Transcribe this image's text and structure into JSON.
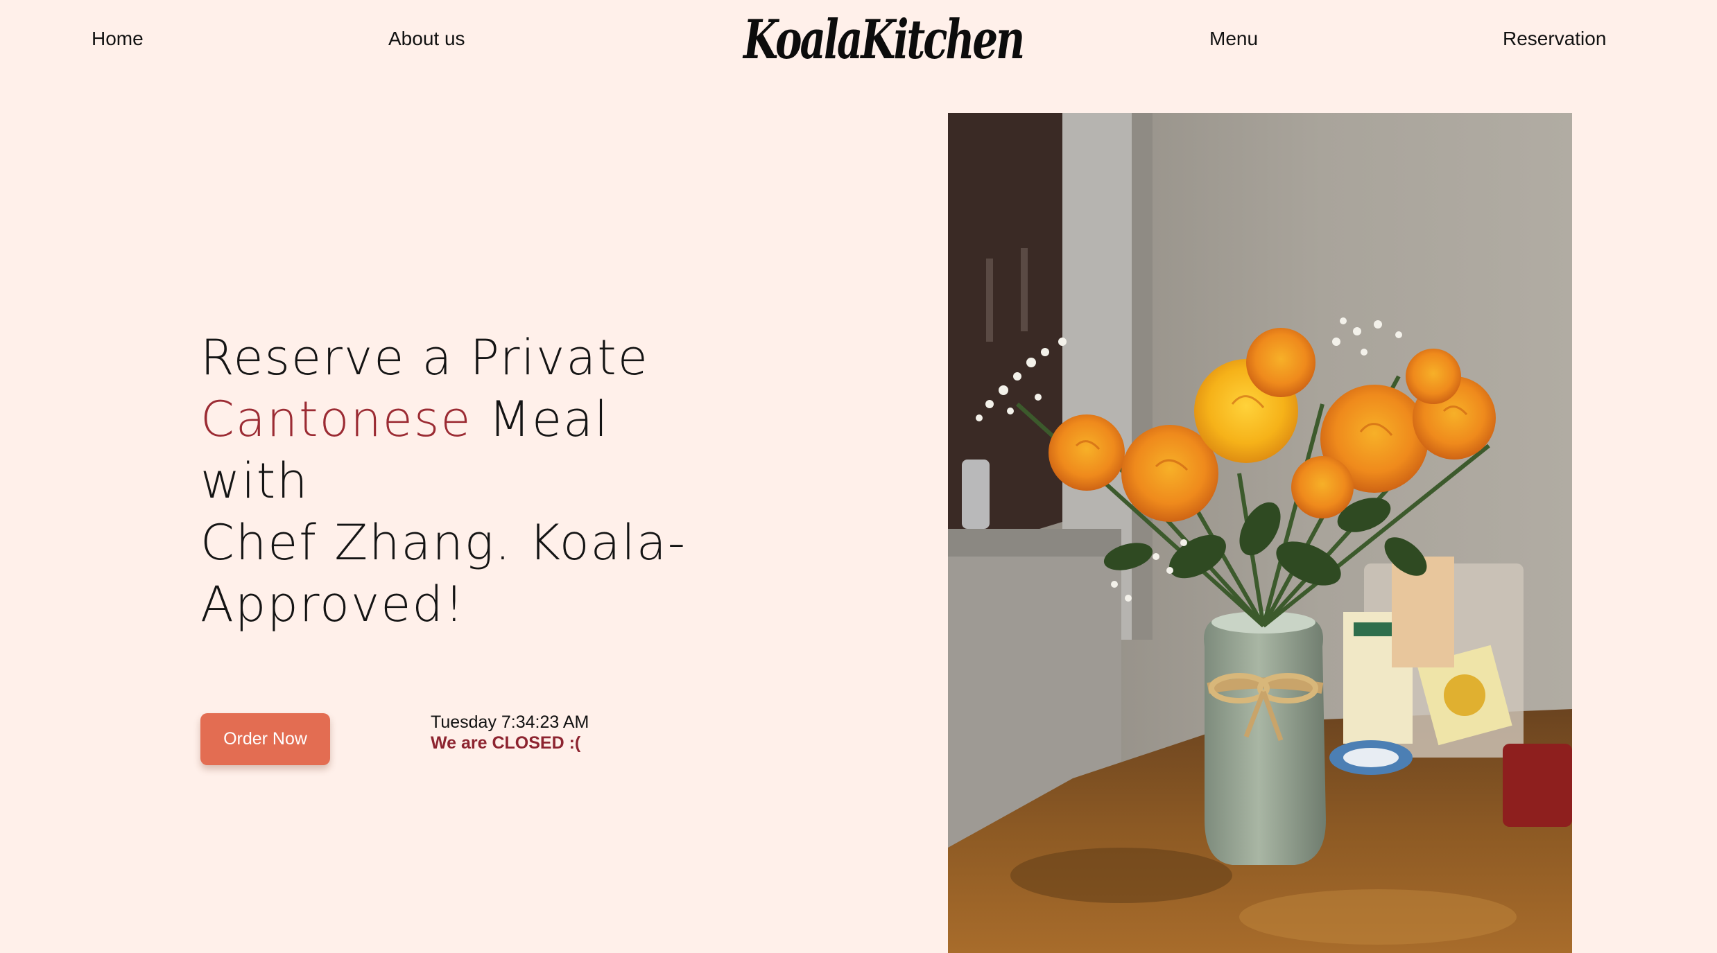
{
  "brand": {
    "logo_text": "KoalaKitchen"
  },
  "nav": {
    "home": "Home",
    "about": "About us",
    "menu": "Menu",
    "reservation": "Reservation"
  },
  "hero": {
    "line1": "Reserve a Private",
    "accent": "Cantonese",
    "line2_rest": " Meal with",
    "line3": "Chef Zhang. Koala-",
    "line4": "Approved!"
  },
  "cta": {
    "order_label": "Order Now"
  },
  "hours": {
    "clock": "Tuesday 7:34:23 AM",
    "status": "We are CLOSED :("
  },
  "photo": {
    "subject": "vase-of-orange-roses"
  },
  "colors": {
    "background": "#fff0ea",
    "accent": "#9b2b33",
    "button": "#e36d52",
    "status": "#8d2430"
  }
}
